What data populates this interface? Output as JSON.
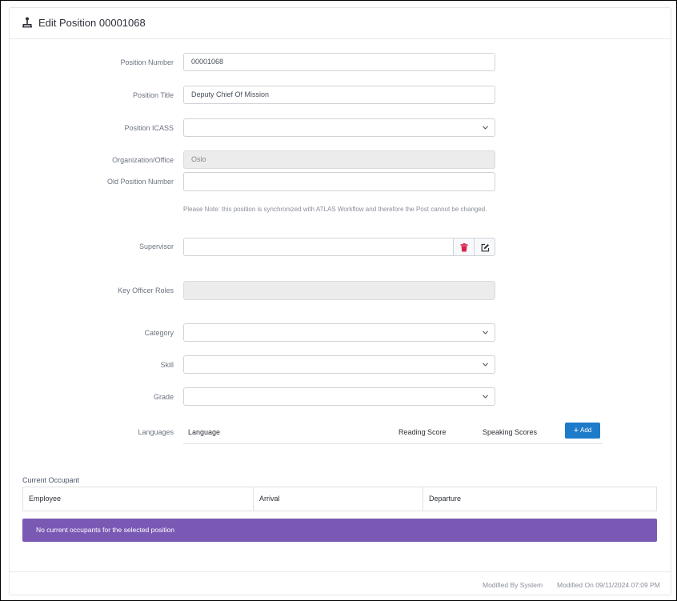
{
  "header": {
    "title": "Edit Position 00001068",
    "icon": "person-hierarchy-icon"
  },
  "form": {
    "position_number": {
      "label": "Position Number",
      "value": "00001068"
    },
    "position_title": {
      "label": "Position Title",
      "value": "Deputy Chief Of Mission"
    },
    "position_icass": {
      "label": "Position ICASS",
      "value": ""
    },
    "organization_office": {
      "label": "Organization/Office",
      "value": "Oslo"
    },
    "old_position_number": {
      "label": "Old Position Number",
      "value": ""
    },
    "note": "Please Note: this position is synchronized with ATLAS Workflow and therefore the Post cannot be changed.",
    "supervisor": {
      "label": "Supervisor",
      "value": ""
    },
    "key_officer_roles": {
      "label": "Key Officer Roles",
      "value": ""
    },
    "category": {
      "label": "Category",
      "value": ""
    },
    "skill": {
      "label": "Skill",
      "value": ""
    },
    "grade": {
      "label": "Grade",
      "value": ""
    },
    "languages": {
      "label": "Languages",
      "columns": [
        "Language",
        "Reading Score",
        "Speaking Scores"
      ],
      "add_label": "Add"
    }
  },
  "occupant": {
    "label": "Current Occupant",
    "columns": [
      "Employee",
      "Arrival",
      "Departure"
    ],
    "empty_message": "No current occupants for the selected position"
  },
  "footer": {
    "modified_by": "Modified By System",
    "modified_on": "Modified On 09/11/2024 07:09 PM"
  },
  "colors": {
    "add_button": "#1e7bc9",
    "empty_banner": "#7a59b5",
    "delete_icon": "#d6224f"
  }
}
